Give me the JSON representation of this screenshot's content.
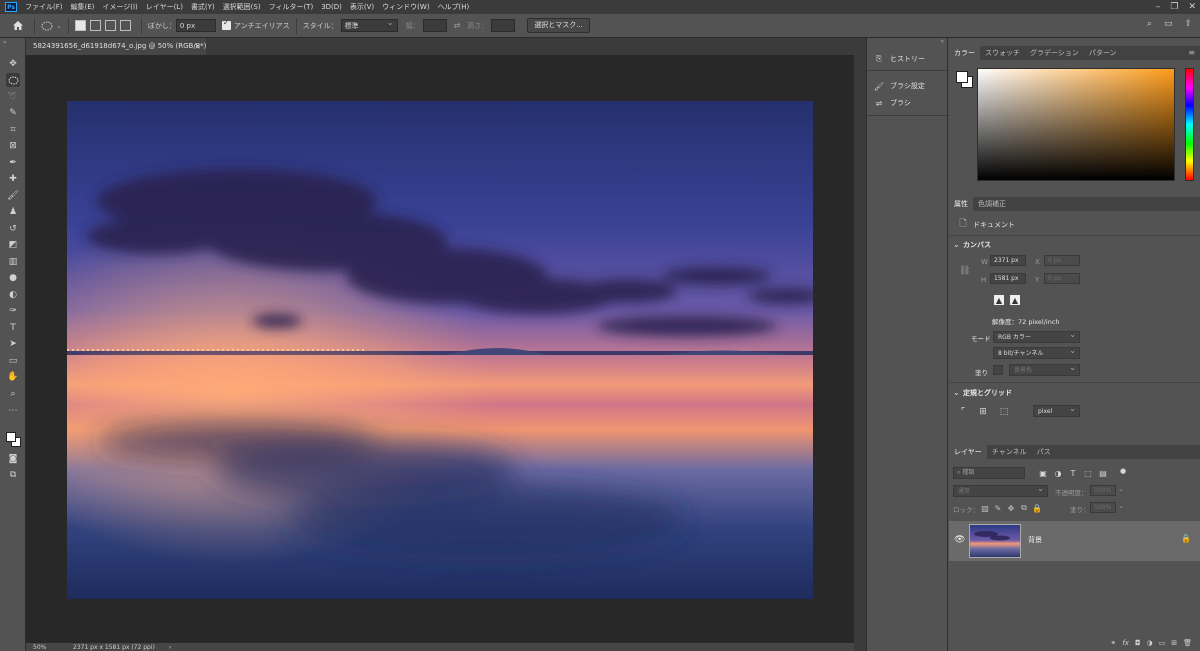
{
  "app": {
    "logo_text": "Ps"
  },
  "menu": [
    "ファイル(F)",
    "編集(E)",
    "イメージ(I)",
    "レイヤー(L)",
    "書式(Y)",
    "選択範囲(S)",
    "フィルター(T)",
    "3D(D)",
    "表示(V)",
    "ウィンドウ(W)",
    "ヘルプ(H)"
  ],
  "options": {
    "feather_label": "ぼかし：",
    "feather_value": "0 px",
    "antialias_label": "アンチエイリアス",
    "style_label": "スタイル：",
    "style_value": "標準",
    "width_label": "幅：",
    "height_label": "高さ：",
    "select_mask_button": "選択とマスク..."
  },
  "document": {
    "tab_title": "5824391656_d61918d674_o.jpg @ 50% (RGB/8*)",
    "close_glyph": "×",
    "zoom": "50%",
    "status_info": "2371 px x 1581 px (72 ppi)",
    "status_arrow": "›"
  },
  "mid_panel": {
    "history": "ヒストリー",
    "brush_settings": "ブラシ設定",
    "brush": "ブラシ"
  },
  "color_panel": {
    "tabs": [
      "カラー",
      "スウォッチ",
      "グラデーション",
      "パターン"
    ],
    "foreground_color": "#ffffff",
    "background_color": "#ffffff"
  },
  "properties_panel": {
    "tabs": [
      "属性",
      "色調補正"
    ],
    "document_label": "ドキュメント",
    "canvas_section": "カンバス",
    "w_label": "W",
    "w_value": "2371 px",
    "h_label": "H",
    "h_value": "1581 px",
    "x_label": "X",
    "x_placeholder": "0 px",
    "y_label": "Y",
    "y_placeholder": "0 px",
    "resolution": "解像度：72 pixel/inch",
    "mode_label": "モード",
    "mode_value": "RGB カラー",
    "bit_depth": "8 bit/チャンネル",
    "fill_label": "塗り",
    "fill_value": "背景色",
    "rulers_section": "定規とグリッド",
    "unit_value": "pixel"
  },
  "layers_panel": {
    "tabs": [
      "レイヤー",
      "チャンネル",
      "パス"
    ],
    "filter_placeholder": "種類",
    "blend_mode": "通常",
    "opacity_label": "不透明度：",
    "opacity_value": "100%",
    "lock_label": "ロック：",
    "fill_label": "塗り：",
    "fill_value": "100%",
    "layer_name": "背景",
    "footer_icons": [
      "link-icon",
      "fx-icon",
      "mask-icon",
      "adjustment-icon",
      "group-icon",
      "new-layer-icon",
      "delete-icon"
    ]
  }
}
